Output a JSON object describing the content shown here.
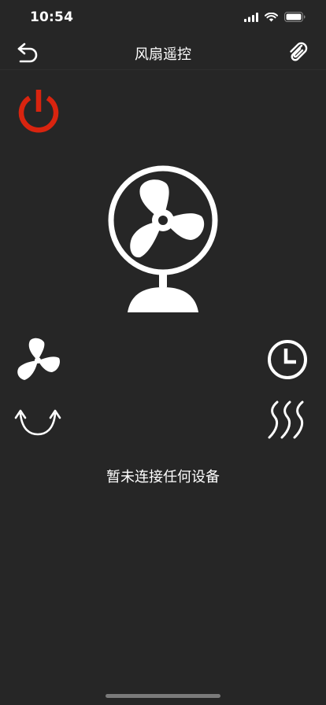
{
  "status_bar": {
    "time": "10:54"
  },
  "nav": {
    "title": "风扇遥控"
  },
  "status": {
    "message": "暂未连接任何设备"
  },
  "colors": {
    "background": "#262626",
    "power": "#d9240f",
    "icon": "#ffffff"
  },
  "icons": {
    "back": "undo-arrow-icon",
    "link": "paperclip-icon",
    "power": "power-icon",
    "fan": "fan-icon",
    "wind": "wind-speed-icon",
    "timer": "timer-icon",
    "swing": "swing-icon",
    "heat": "heat-mode-icon"
  }
}
